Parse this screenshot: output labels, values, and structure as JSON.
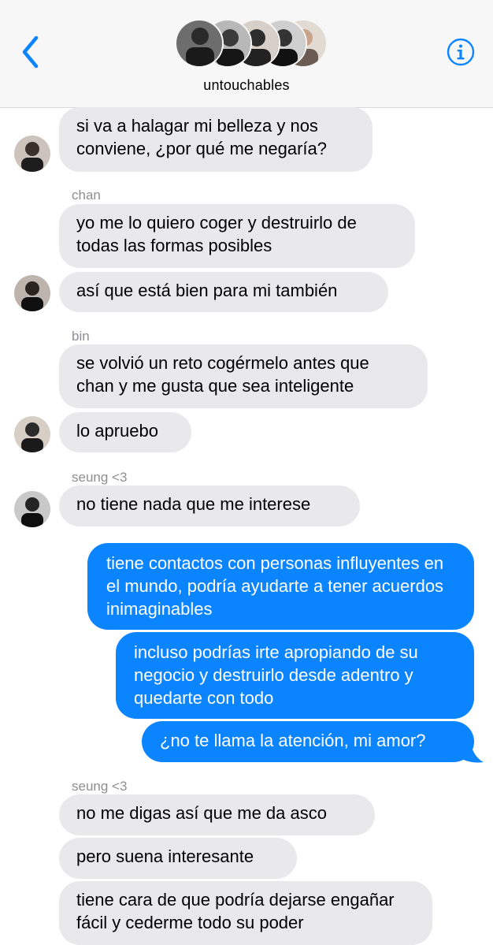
{
  "header": {
    "group_name": "untouchables",
    "avatars": [
      "group-member-1",
      "group-member-2",
      "group-member-3",
      "group-member-4",
      "group-member-5"
    ],
    "icons": {
      "back": "chevron-left-icon",
      "info": "info-circle-icon"
    },
    "accent_color": "#0a84ff"
  },
  "colors": {
    "incoming_bubble": "#e9e9eb",
    "outgoing_bubble": "#0a84ff",
    "sender_label": "#8e8e93"
  },
  "messages": [
    {
      "text": "si va a halagar mi belleza y nos conviene, ¿por qué me negaría?"
    },
    {
      "sender": "chan",
      "text": "yo me lo quiero coger y destruirlo de todas las formas posibles"
    },
    {
      "text": "así que está bien para mi también"
    },
    {
      "sender": "bin",
      "text": "se volvió un reto cogérmelo antes que chan y me gusta que sea inteligente"
    },
    {
      "text": "lo apruebo"
    },
    {
      "sender": "seung <3",
      "text": "no tiene nada que me interese"
    },
    {
      "text": "tiene contactos con personas influyentes en el mundo, podría ayudarte a tener acuerdos inimaginables"
    },
    {
      "text": "incluso podrías irte apropiando de su negocio y destruirlo desde adentro y quedarte con todo"
    },
    {
      "text": "¿no te llama la atención, mi amor?"
    },
    {
      "sender": "seung <3",
      "text": "no me digas así que me da asco"
    },
    {
      "text": "pero suena interesante"
    },
    {
      "text": "tiene cara de que podría dejarse engañar fácil y cederme todo su poder"
    }
  ]
}
